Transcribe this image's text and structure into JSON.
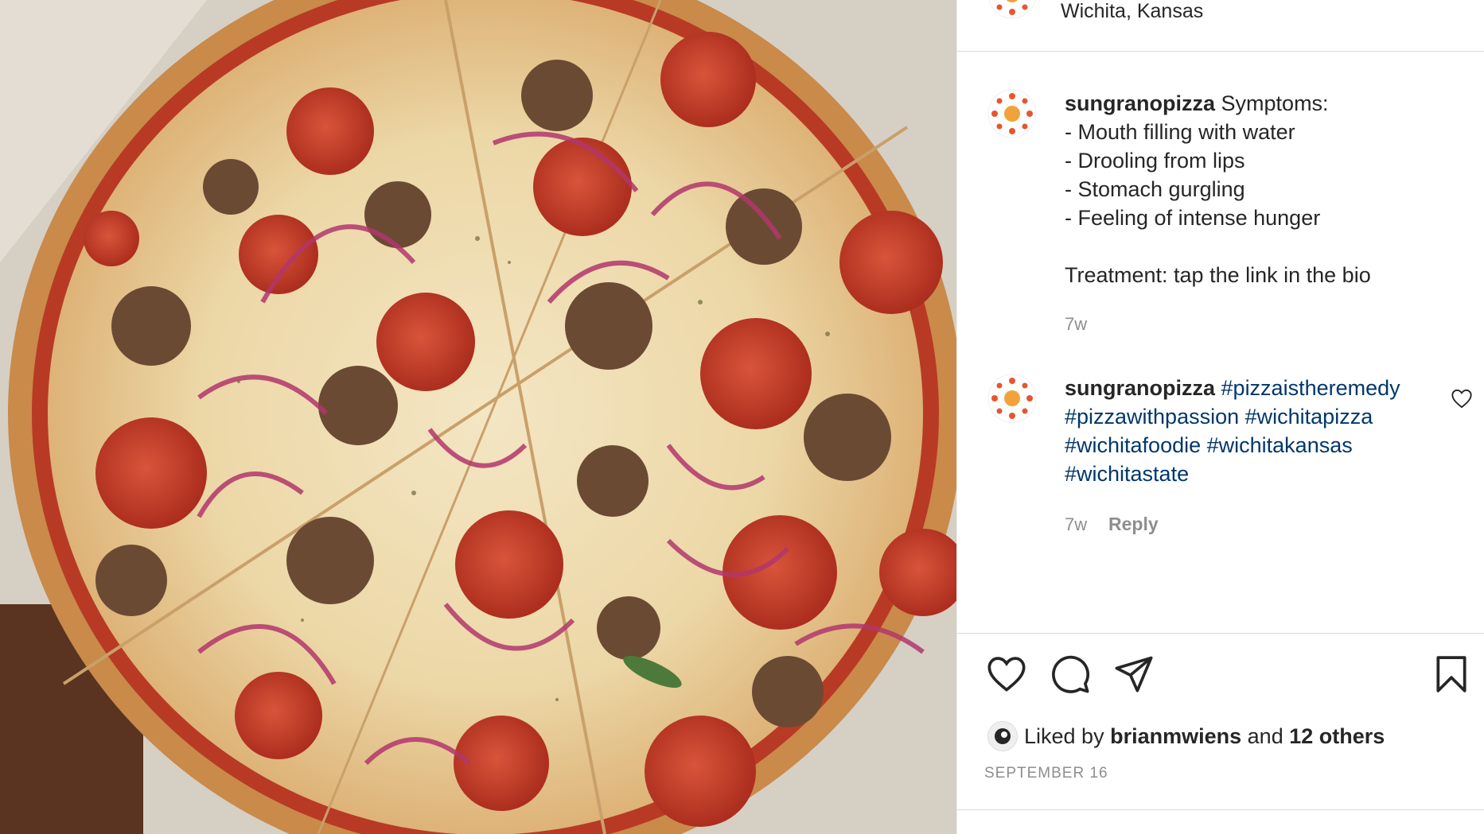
{
  "post": {
    "location": "Wichita, Kansas",
    "caption": {
      "username": "sungranopizza",
      "first_line": "Symptoms:",
      "lines": [
        "- Mouth filling with water",
        "- Drooling from lips",
        "- Stomach gurgling",
        "- Feeling of intense hunger",
        "",
        "Treatment: tap the link in the bio"
      ],
      "time": "7w"
    },
    "comment": {
      "username": "sungranopizza",
      "hashtags": [
        "#pizzaistheremedy",
        "#pizzawithpassion",
        "#wichitapizza",
        "#wichitafoodie",
        "#wichitakansas",
        "#wichitastate"
      ],
      "time": "7w",
      "reply_label": "Reply"
    },
    "likes": {
      "prefix": "Liked by",
      "user": "brianmwiens",
      "conjunction": "and",
      "others": "12 others"
    },
    "date": "SEPTEMBER 16"
  },
  "icons": {
    "like": "heart-icon",
    "comment": "comment-icon",
    "share": "paper-plane-icon",
    "save": "bookmark-icon",
    "comment_like": "heart-icon-small"
  },
  "colors": {
    "hashtag": "#00376b",
    "muted": "#8e8e8e",
    "text": "#262626"
  }
}
